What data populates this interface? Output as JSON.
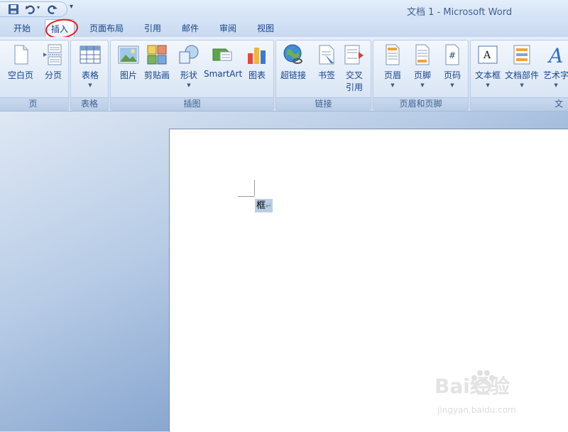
{
  "window": {
    "title": "文档 1 - Microsoft Word"
  },
  "quick_access": {
    "more_glyph": "▾"
  },
  "tabs": [
    {
      "label": "开始"
    },
    {
      "label": "插入"
    },
    {
      "label": "页面布局"
    },
    {
      "label": "引用"
    },
    {
      "label": "邮件"
    },
    {
      "label": "审阅"
    },
    {
      "label": "视图"
    }
  ],
  "ribbon": {
    "groups": [
      {
        "label": "页"
      },
      {
        "label": "表格"
      },
      {
        "label": "插图"
      },
      {
        "label": "链接"
      },
      {
        "label": "页眉和页脚"
      },
      {
        "label": "文"
      }
    ],
    "buttons": {
      "blank_page": "空白页",
      "page_break": "分页",
      "table": "表格",
      "picture": "图片",
      "clip_art": "剪贴画",
      "shapes": "形状",
      "smartart": "SmartArt",
      "chart": "图表",
      "hyperlink": "超链接",
      "bookmark": "书签",
      "cross_ref_line1": "交叉",
      "cross_ref_line2": "引用",
      "header": "页眉",
      "footer": "页脚",
      "page_number": "页码",
      "text_box": "文本框",
      "quick_parts": "文档部件",
      "wordart": "艺术字"
    }
  },
  "document": {
    "selected_text": "框",
    "paragraph_mark": "↵"
  },
  "watermark": {
    "brand": "Bai经验",
    "url": "jingyan.baidu.com"
  },
  "colors": {
    "annotation": "#e0201b",
    "selection": "#b9cde6"
  }
}
